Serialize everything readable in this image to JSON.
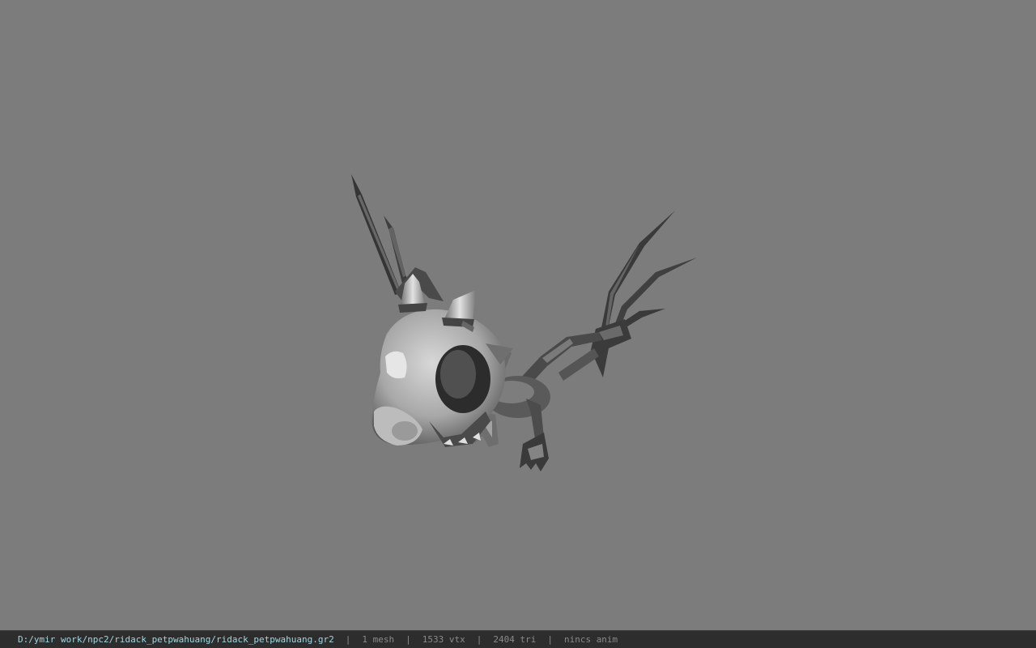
{
  "viewport": {
    "background_color": "#7c7c7c",
    "model": "skeletal-dragon-pet"
  },
  "statusbar": {
    "file_path": "D:/ymir work/npc2/ridack_petpwahuang/ridack_petpwahuang.gr2",
    "separator": "|",
    "mesh_count": "1 mesh",
    "vertex_count": "1533 vtx",
    "triangle_count": "2404 tri",
    "anim_status": "nincs anim",
    "path_color": "#9fd8e0",
    "bar_color": "#2d2d2d"
  }
}
